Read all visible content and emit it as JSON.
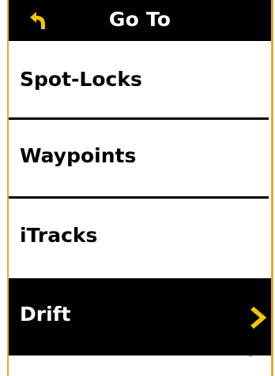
{
  "header": {
    "title": "Go To",
    "back_icon": "back-arrow-icon",
    "accent": "#f4c600"
  },
  "menu": {
    "items": [
      {
        "label": "Spot-Locks",
        "selected": false
      },
      {
        "label": "Waypoints",
        "selected": false
      },
      {
        "label": "iTracks",
        "selected": false
      },
      {
        "label": "Drift",
        "selected": true
      }
    ]
  },
  "selected_indicator_icon": "chevron-right-icon",
  "colors": {
    "background": "#ffffff",
    "bar": "#000000",
    "frame": "#e8a92e",
    "text": "#000000",
    "selected_text": "#ffffff"
  }
}
